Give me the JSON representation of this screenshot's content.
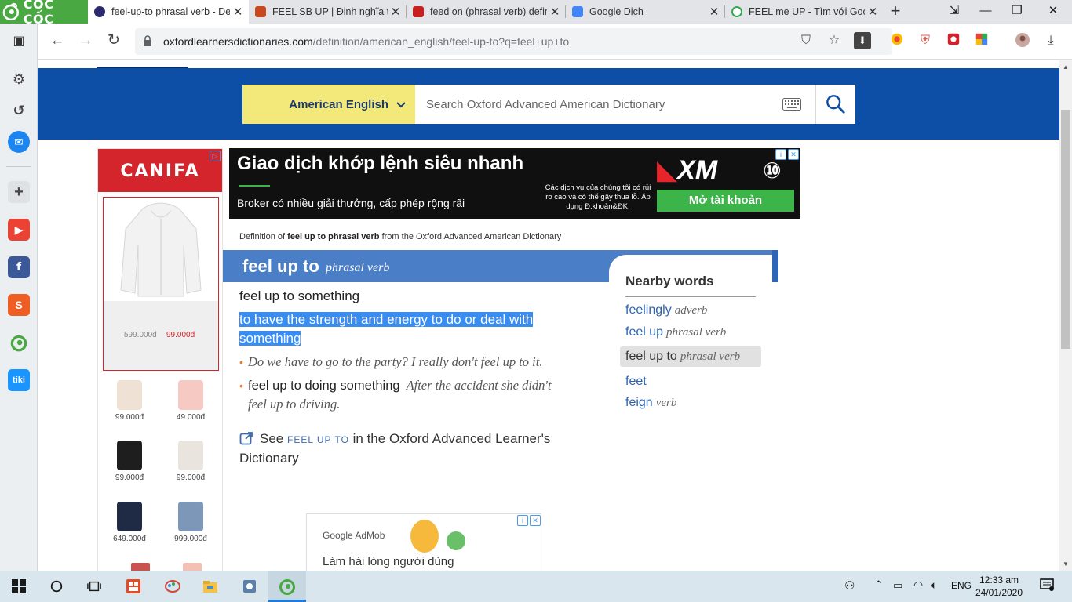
{
  "browser": {
    "brand_name": "CỐC CỐC",
    "tabs": [
      {
        "title": "feel-up-to phrasal verb - De",
        "favicon_color": "#2b2b6e",
        "active": true
      },
      {
        "title": "FEEL SB UP | Định nghĩa tro",
        "favicon_color": "#c8481f",
        "active": false
      },
      {
        "title": "feed on (phrasal verb) defin",
        "favicon_color": "#c8201f",
        "active": false
      },
      {
        "title": "Google Dịch",
        "favicon_color": "#4285f4",
        "active": false
      },
      {
        "title": "FEEL me UP - Tìm với Goog",
        "favicon_color": "#34a853",
        "active": false
      }
    ],
    "url_host": "oxfordlearnersdictionaries.com",
    "url_path": "/definition/american_english/feel-up-to?q=feel+up+to"
  },
  "page": {
    "dictionary_select": "American English",
    "search_placeholder": "Search Oxford Advanced American Dictionary",
    "breadcrumb": {
      "prefix": "Definition of ",
      "term": "feel up to phrasal verb",
      "suffix": " from the Oxford Advanced American Dictionary"
    },
    "entry": {
      "headword": "feel up to",
      "pos": "phrasal verb",
      "phrase": "feel up to something",
      "definition_line1": "to have the strength and energy to do or deal with",
      "definition_line2": "something",
      "example1": "Do we have to go to the party? I really don't feel up to it.",
      "example2_collocation": "feel up to doing something",
      "example2_text_line1": "After the accident she didn't",
      "example2_text_line2": "feel up to driving.",
      "see_prefix": "See ",
      "see_term": "FEEL UP TO",
      "see_suffix_line1": " in the Oxford Advanced Learner's",
      "see_suffix_line2": "Dictionary"
    },
    "nearby": {
      "title": "Nearby words",
      "words": [
        {
          "word": "feelingly",
          "pos": "adverb"
        },
        {
          "word": "feel up",
          "pos": "phrasal verb"
        },
        {
          "word": "feel up to",
          "pos": "phrasal verb"
        },
        {
          "word": "feet",
          "pos": ""
        },
        {
          "word": "feign",
          "pos": "verb"
        }
      ]
    },
    "ads": {
      "canifa_brand": "CANIFA",
      "canifa_old_price": "599.000đ",
      "canifa_new_price": "99.000đ",
      "canifa_products": [
        "99.000đ",
        "49.000đ",
        "99.000đ",
        "99.000đ",
        "649.000đ",
        "999.000đ"
      ],
      "xm_headline": "Giao dịch khớp lệnh siêu nhanh",
      "xm_subline": "Broker có nhiều giải thưởng, cấp phép rộng rãi",
      "xm_fine_print": "Các dịch vụ của chúng tôi có rủi ro cao và có thể gây thua lỗ. Áp dụng Đ.khoản&ĐK.",
      "xm_logo": "XM",
      "xm_cta": "Mở tài khoản",
      "admob_brand": "Google AdMob",
      "admob_text": "Làm hài lòng người dùng"
    }
  },
  "taskbar": {
    "language": "ENG",
    "time": "12:33 am",
    "date": "24/01/2020"
  }
}
